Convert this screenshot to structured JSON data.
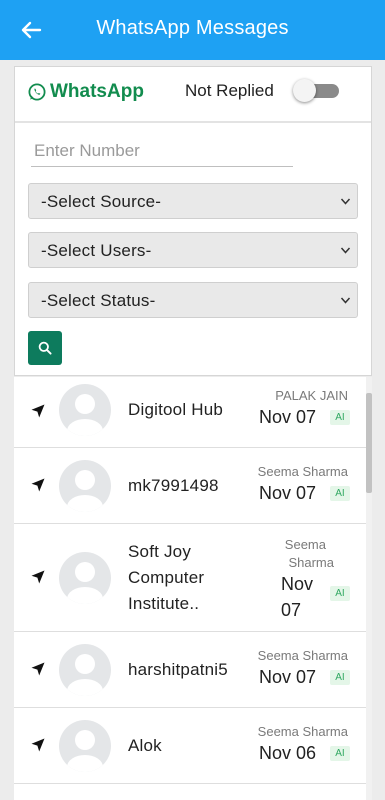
{
  "header": {
    "title": "WhatsApp Messages"
  },
  "brand": {
    "label": "WhatsApp",
    "color": "#128c4e"
  },
  "filters": {
    "not_replied_label": "Not Replied",
    "not_replied_on": false,
    "number_placeholder": "Enter Number",
    "source": "-Select Source-",
    "users": "-Select Users-",
    "status": "-Select Status-"
  },
  "icons": {
    "back": "arrow-left-icon",
    "search": "search-icon",
    "row": "navigation-arrow-icon",
    "avatar": "person-placeholder-icon"
  },
  "colors": {
    "appbar": "#1ea1f3",
    "accent": "#0d7b5d",
    "badge_bg": "#e4f6e8",
    "badge_text": "#2fa860"
  },
  "conversations": [
    {
      "name": "Digitool Hub",
      "agent": "PALAK JAIN",
      "date": "Nov 07",
      "badge": "AI"
    },
    {
      "name": "mk7991498",
      "agent": "Seema Sharma",
      "date": "Nov 07",
      "badge": "AI"
    },
    {
      "name_lines": [
        "Soft Joy",
        "Computer",
        "Institute.."
      ],
      "agent_lines": [
        "Seema",
        "Sharma"
      ],
      "date_lines": [
        "Nov",
        "07"
      ],
      "badge": "AI"
    },
    {
      "name": "harshitpatni5",
      "agent": "Seema Sharma",
      "date": "Nov 07",
      "badge": "AI"
    },
    {
      "name": "Alok",
      "agent": "Seema Sharma",
      "date": "Nov 06",
      "badge": "AI"
    }
  ]
}
